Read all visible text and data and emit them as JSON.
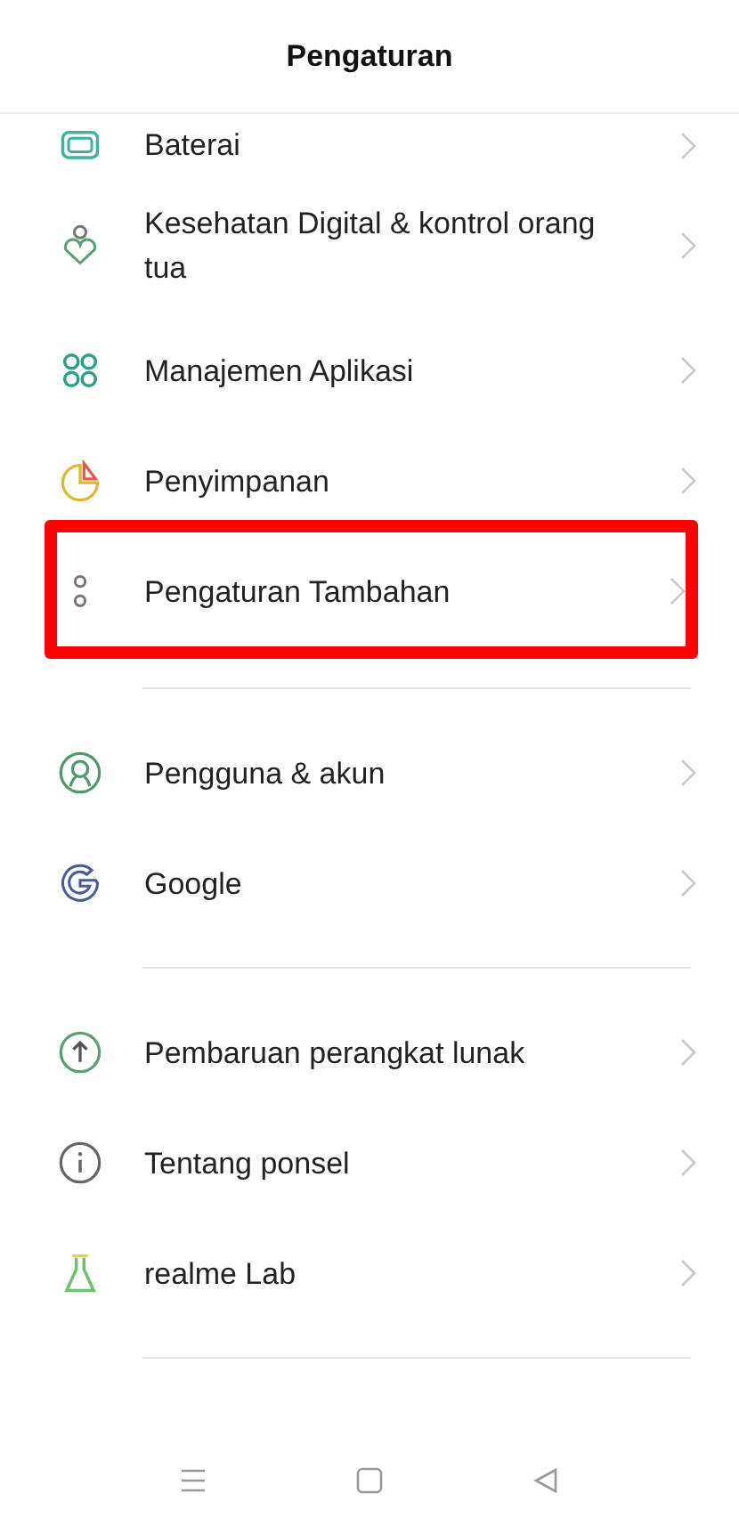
{
  "header": {
    "title": "Pengaturan"
  },
  "groups": [
    {
      "items": [
        {
          "label": "Baterai",
          "highlighted": false
        },
        {
          "label": "Kesehatan Digital & kontrol orang tua",
          "highlighted": false
        },
        {
          "label": "Manajemen Aplikasi",
          "highlighted": false
        },
        {
          "label": "Penyimpanan",
          "highlighted": false
        },
        {
          "label": "Pengaturan Tambahan",
          "highlighted": true
        }
      ]
    },
    {
      "items": [
        {
          "label": "Pengguna & akun",
          "highlighted": false
        },
        {
          "label": "Google",
          "highlighted": false
        }
      ]
    },
    {
      "items": [
        {
          "label": "Pembaruan perangkat lunak",
          "highlighted": false
        },
        {
          "label": "Tentang ponsel",
          "highlighted": false
        },
        {
          "label": "realme Lab",
          "highlighted": false
        }
      ]
    }
  ]
}
